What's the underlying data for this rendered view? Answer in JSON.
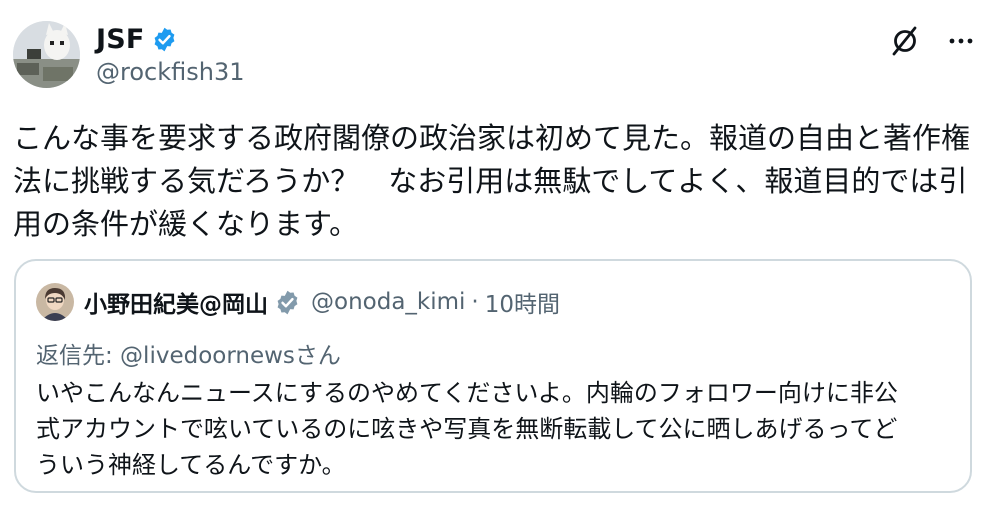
{
  "tweet": {
    "author": {
      "display_name": "JSF",
      "handle": "@rockfish31",
      "verified": true,
      "avatar_icon": "avatar-image"
    },
    "text": "こんな事を要求する政府閣僚の政治家は初めて見た。報道の自由と著作権\n法に挑戦する気だろうか？　なお引用は無駄でしてよく、報道目的では引\n用の条件が緩くなります。",
    "actions": {
      "grok_icon": "grok-icon",
      "more_icon": "more-icon"
    }
  },
  "quote": {
    "author": {
      "display_name": "小野田紀美@岡山",
      "handle": "@onoda_kimi",
      "verified": true,
      "verified_badge_color": "#829aab"
    },
    "separator": "·",
    "time": "10時間",
    "reply_to": "返信先: @livedoornewsさん",
    "text": "いやこんなんニュースにするのやめてくださいよ。内輪のフォロワー向けに非公\n式アカウントで呟いているのに呟きや写真を無断転載して公に晒しあげるってど\nういう神経してるんですか。"
  },
  "colors": {
    "verified_blue": "#1d9bf0",
    "secondary_text": "#536471",
    "border": "#cfd9de"
  }
}
